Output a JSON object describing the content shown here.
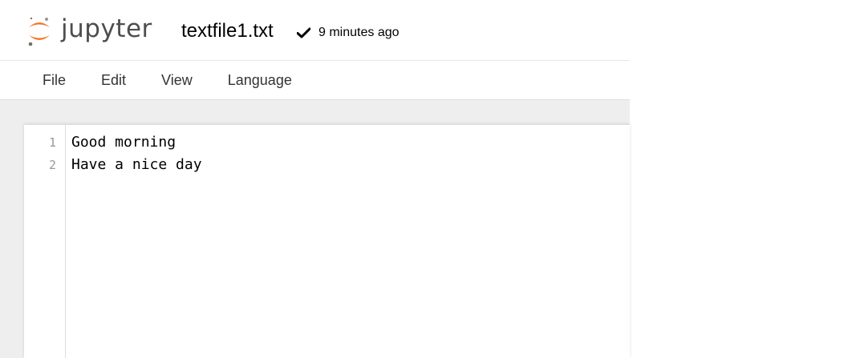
{
  "header": {
    "logo_text": "jupyter",
    "notebook_name": "textfile1.txt",
    "save_status": "9 minutes ago"
  },
  "menubar": {
    "items": [
      {
        "label": "File"
      },
      {
        "label": "Edit"
      },
      {
        "label": "View"
      },
      {
        "label": "Language"
      }
    ]
  },
  "editor": {
    "lines": [
      {
        "number": "1",
        "text": "Good morning"
      },
      {
        "number": "2",
        "text": "Have a nice day"
      }
    ]
  },
  "colors": {
    "logo_orange": "#f37626",
    "logo_grey": "#767677",
    "background_gray": "#eeeeee"
  },
  "icons": {
    "logo": "jupyter-logo-icon",
    "saved": "checkmark-icon"
  }
}
